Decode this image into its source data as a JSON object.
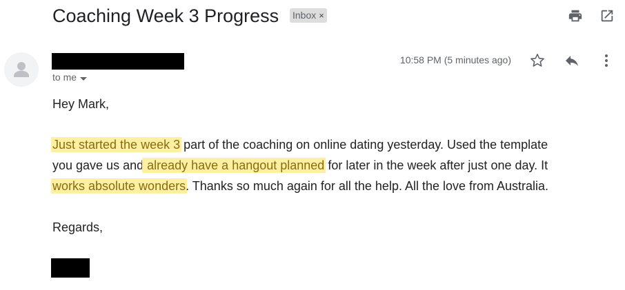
{
  "email": {
    "subject": "Coaching Week 3 Progress",
    "label": "Inbox",
    "label_remove": "×",
    "recipient": "to me",
    "timestamp": "10:58 PM (5 minutes ago)"
  },
  "icons": {
    "print": "print-icon",
    "open_new_window": "open-in-new-window-icon",
    "star": "star-icon",
    "reply": "reply-icon",
    "more": "more-vertical-icon",
    "avatar": "person-avatar-icon",
    "caret": "caret-down-icon"
  },
  "body": {
    "greeting": "Hey Mark,",
    "line1": {
      "hl1": "Just started the week 3",
      "t1": " part of the coaching on online dating yesterday. Used the template"
    },
    "line2": {
      "t1": "you gave us and",
      "hl2": " already have a hangout planned",
      "t2": " for later in the week after just one day. It"
    },
    "line3": {
      "hl3": "works absolute wonders",
      "t1": ". Thanks so much again for all the help. All the love from Australia."
    },
    "closing": "Regards,"
  },
  "colors": {
    "highlight_bg": "#fdf0a2",
    "highlight_text": "#8a6c10",
    "chip_bg": "#dddddd",
    "redaction": "#000000"
  }
}
